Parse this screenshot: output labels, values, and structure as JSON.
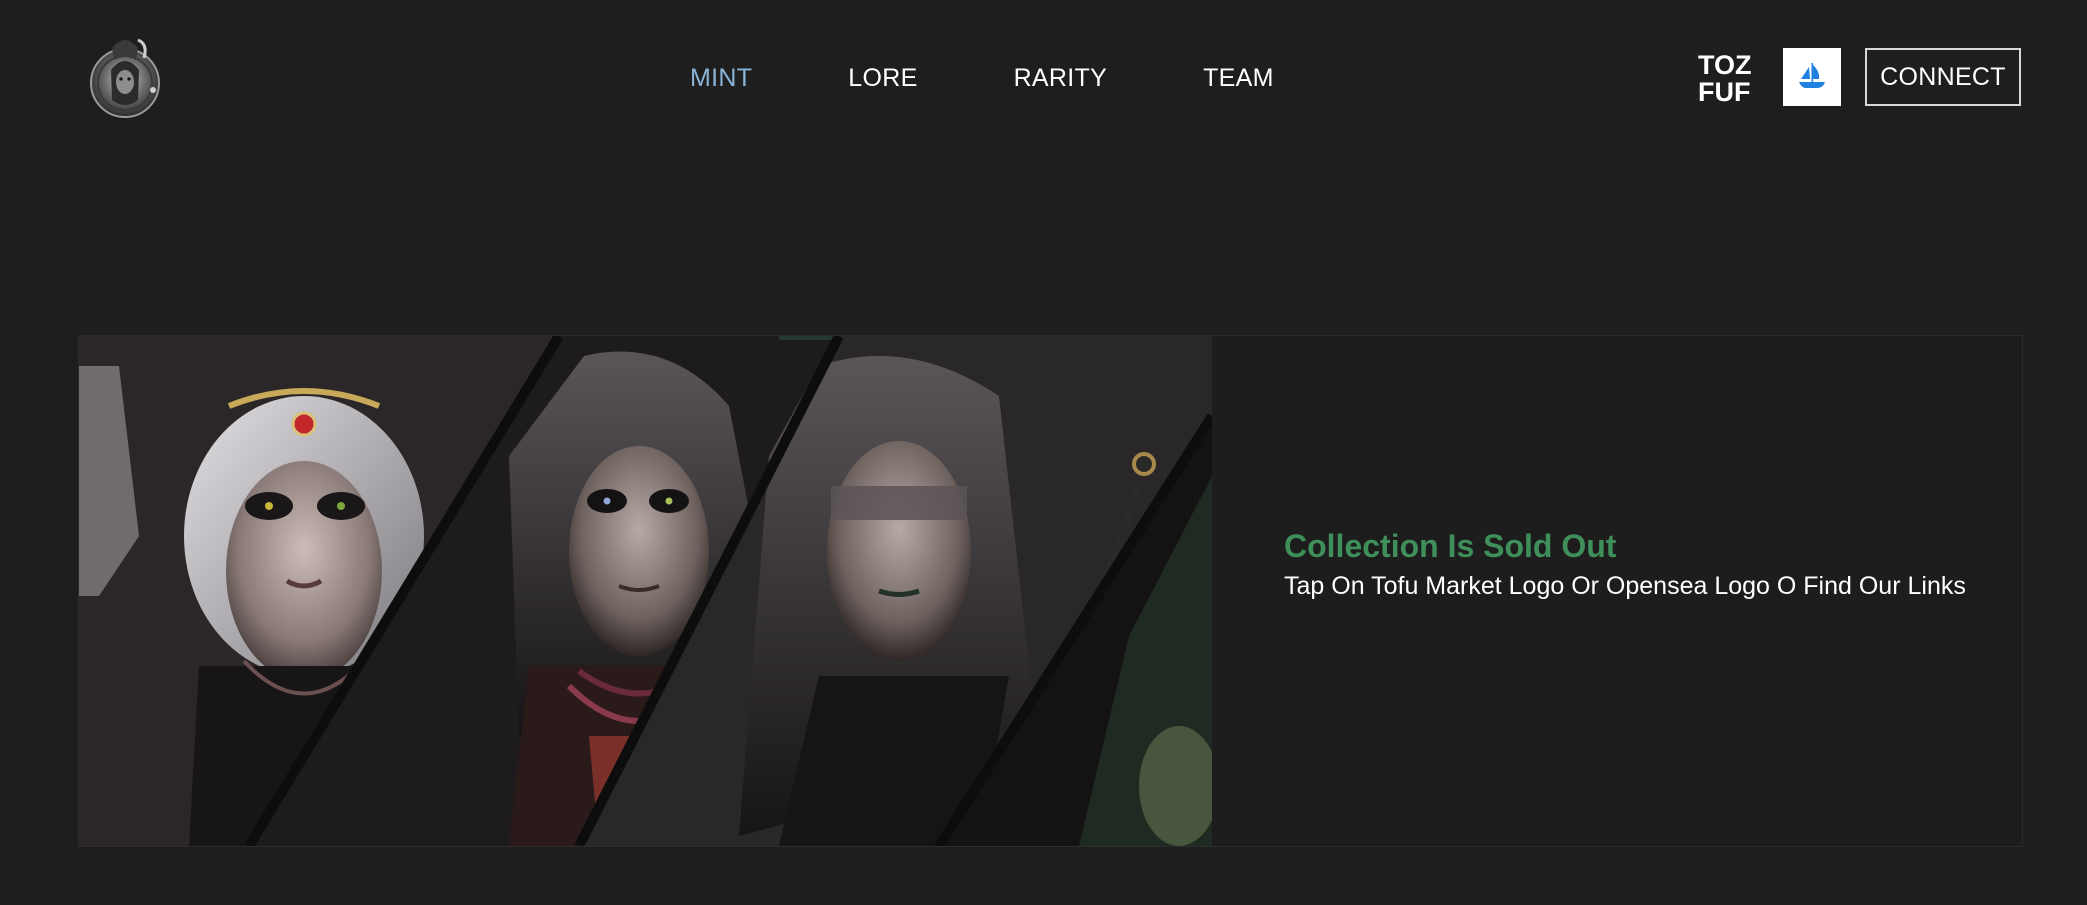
{
  "header": {
    "logo_icon": "hooded-figure-medallion-icon",
    "nav": [
      {
        "label": "MINT",
        "active": true
      },
      {
        "label": "LORE",
        "active": false
      },
      {
        "label": "RARITY",
        "active": false
      },
      {
        "label": "TEAM",
        "active": false
      }
    ],
    "tofu_logo_text": [
      "TOZ",
      "FUF"
    ],
    "opensea_icon": "opensea-ship-icon",
    "connect_label": "CONNECT"
  },
  "hero": {
    "artwork_icon": "four-characters-portrait-collage",
    "title": "Collection Is Sold Out",
    "description": "Tap On Tofu Market Logo Or Opensea Logo O Find Our Links"
  },
  "colors": {
    "background": "#1e1e1e",
    "nav_active": "#8ab4d8",
    "sold_out_green": "#3f8f5a",
    "opensea_blue": "#2081e2"
  }
}
